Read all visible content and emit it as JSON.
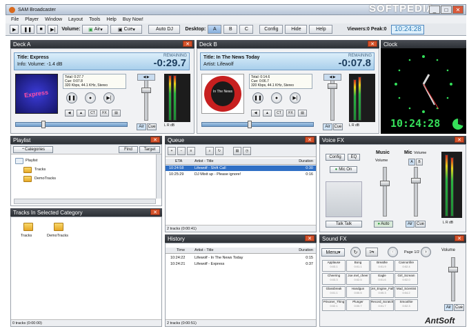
{
  "window": {
    "title": "SAM Broadcaster",
    "watermark": "SOFTPEDIA",
    "controls": [
      "_",
      "□",
      "✕"
    ]
  },
  "menu": [
    "File",
    "Player",
    "Window",
    "Layout",
    "Tools",
    "Help",
    "Buy Now!"
  ],
  "toolbar": {
    "volume_label": "Volume:",
    "air_select": "Air",
    "cue_select": "Cue",
    "auto_dj": "Auto DJ",
    "desktop_label": "Desktop:",
    "desktops": [
      "A",
      "B",
      "C"
    ],
    "config": "Config",
    "hide": "Hide",
    "help": "Help",
    "viewers": "Viewers:0 Peak:0",
    "clock": "10:24:28"
  },
  "deck_a": {
    "title": "Deck A",
    "track_title": "Title: Express",
    "info": "Info: Volume: -1.4 dB",
    "remaining_label": "REMAINING",
    "remaining": "-0:29.7",
    "art_text": "Express",
    "stats": [
      "Total: 0:27.7",
      "Cue: 0:07.8",
      "320 Kbps, 44.1 KHz, Stereo"
    ],
    "small_buttons": [
      "◀",
      "▲",
      "CT",
      "FX",
      "▤"
    ],
    "auto_btn": "Air",
    "cue_btn": "Cue",
    "meter_label": "L R dB",
    "progress": 0.24
  },
  "deck_b": {
    "title": "Deck B",
    "track_title": "Title: In The News Today",
    "info": "Artist: Lifewolf",
    "remaining_label": "REMAINING",
    "remaining": "-0:07.8",
    "art_text": "In The News",
    "stats": [
      "Total: 0:14.6",
      "Cue: 0:06.7",
      "320 Kbps, 44.1 KHz, Stereo"
    ],
    "small_buttons": [
      "◀",
      "▲",
      "CT",
      "FX",
      "▤"
    ],
    "auto_btn": "Air",
    "cue_btn": "Cue",
    "meter_label": "L R dB",
    "progress": 0.42
  },
  "clock_panel": {
    "title": "Clock",
    "digital": "10:24:28"
  },
  "playlist": {
    "title": "Playlist",
    "categories_btn": "Categories",
    "find_btn": "Find",
    "target_btn": "Target",
    "tree": [
      "Playlist",
      "Tracks",
      "DemoTracks"
    ]
  },
  "tracks_in_category": {
    "title": "Tracks In Selected Category",
    "folders": [
      "Tracks",
      "DemoTracks"
    ],
    "status": "0 tracks (0:00:00)"
  },
  "queue": {
    "title": "Queue",
    "columns": [
      "ETA",
      "Artist - Title",
      "Duration"
    ],
    "rows": [
      {
        "eta": "10:24:58",
        "title": "Lifewolf - Shift Call",
        "duration": "0:30",
        "selected": true
      },
      {
        "eta": "10:25:29",
        "title": "DJ Mixit up - Please ignore!",
        "duration": "0:16",
        "selected": false
      }
    ],
    "status": "2 tracks (0:00:41)"
  },
  "history": {
    "title": "History",
    "columns": [
      "Time",
      "Artist - Title",
      "Duration"
    ],
    "rows": [
      {
        "time": "10:24:22",
        "title": "Lifewolf - In The News Today",
        "duration": "0:15"
      },
      {
        "time": "10:24:21",
        "title": "Lifewolf - Express",
        "duration": "0:37"
      }
    ],
    "status": "2 tracks (0:00:51)"
  },
  "voice_fx": {
    "title": "Voice FX",
    "config_btn": "Config",
    "eq_btn": "EQ",
    "mic_on": "Mic On",
    "music_label": "Music",
    "mic_label": "Mic",
    "volume_label": "Volume",
    "ab_buttons": [
      "A",
      "B"
    ],
    "auto_btn": "Auto",
    "air_btn": "Air",
    "cue_btn": "Cue",
    "talk_btn": "Talk Talk",
    "meter_label": "L R dB"
  },
  "sound_fx": {
    "title": "Sound FX",
    "menu": "Menu",
    "page": "Page 1/2",
    "volume_label": "Volume",
    "air_btn": "Air",
    "cue_btn": "Cue",
    "brand": "AntSoft",
    "cells": [
      {
        "name": "Applause",
        "key": "0:03.1"
      },
      {
        "name": "Bong",
        "key": "0:01.1"
      },
      {
        "name": "Breathe",
        "key": "0:01.9"
      },
      {
        "name": "Cannonfire",
        "key": "0:02.4"
      },
      {
        "name": "Cheering",
        "key": "0:03.3"
      },
      {
        "name": "Joe.mel_cheer",
        "key": "0:02.5"
      },
      {
        "name": "Eagle",
        "key": "0:01.6"
      },
      {
        "name": "Girl_Scream",
        "key": "0:02.0"
      },
      {
        "name": "Glassbreak",
        "key": "0:01.1"
      },
      {
        "name": "Handgun",
        "key": "0:00.5"
      },
      {
        "name": "Jet_Engine_Fail",
        "key": "0:05.3"
      },
      {
        "name": "Mad_Scientist",
        "key": "0:04.2"
      },
      {
        "name": "Prisoner_Thing",
        "key": "0:02.1"
      },
      {
        "name": "Plunger",
        "key": "0:00.7"
      },
      {
        "name": "Record_Scratch",
        "key": "0:01.7"
      },
      {
        "name": "Smoothie",
        "key": "0:02.3"
      }
    ]
  }
}
